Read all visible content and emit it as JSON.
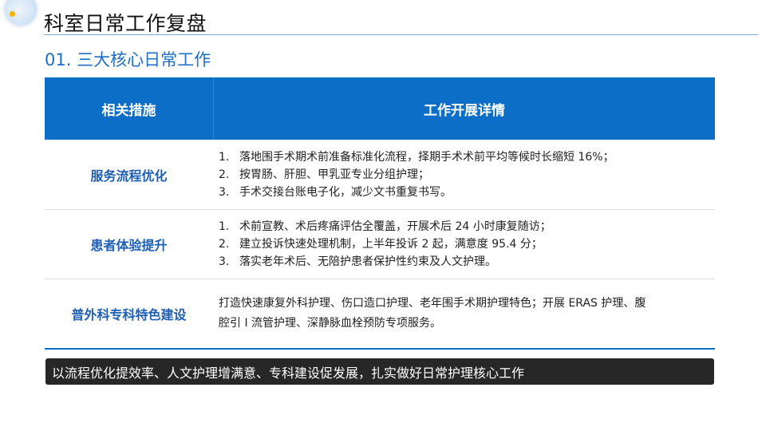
{
  "page": {
    "title": "科室日常工作复盘",
    "subtitle": "01. 三大核心日常工作"
  },
  "table": {
    "headers": [
      "相关措施",
      "工作开展详情"
    ],
    "rows": [
      {
        "measure": "服务流程优化",
        "items": [
          {
            "num": "1.",
            "text": "落地围手术期术前准备标准化流程，择期手术术前平均等候时长缩短 16%；"
          },
          {
            "num": "2.",
            "text": "按胃肠、肝胆、甲乳亚专业分组护理；"
          },
          {
            "num": "3.",
            "text": "手术交接台账电子化，减少文书重复书写。"
          }
        ]
      },
      {
        "measure": "患者体验提升",
        "items": [
          {
            "num": "1.",
            "text": "术前宣教、术后疼痛评估全覆盖，开展术后 24 小时康复随访；"
          },
          {
            "num": "2.",
            "text": "建立投诉快速处理机制，上半年投诉 2 起，满意度 95.4 分；"
          },
          {
            "num": "3.",
            "text": "落实老年术后、无陪护患者保护性约束及人文护理。"
          }
        ]
      },
      {
        "measure": "普外科专科特色建设",
        "paragraph_line1": "打造快速康复外科护理、伤口造口护理、老年围手术期护理特色；开展 ERAS 护理、腹",
        "paragraph_line2": "腔引 I 流管护理、深静脉血栓预防专项服务。"
      }
    ]
  },
  "banner": {
    "text": "以流程优化提效率、人文护理增满意、专科建设促发展，扎实做好日常护理核心工作"
  },
  "colors": {
    "header_bg": "#0d6ec7",
    "accent_text": "#1f5fb3",
    "subtitle": "#1f6fc4",
    "banner_bg": "#272727"
  }
}
